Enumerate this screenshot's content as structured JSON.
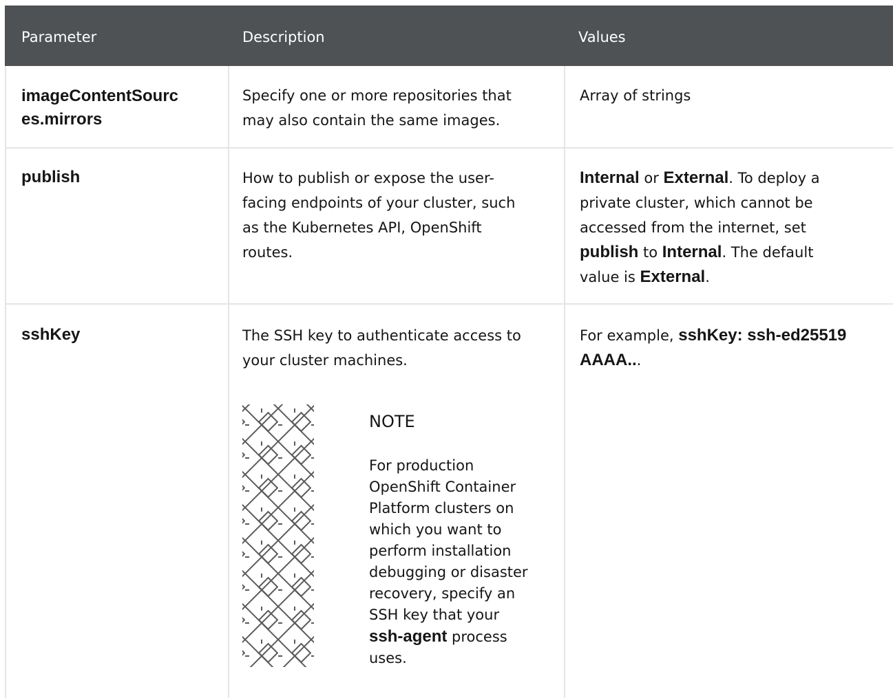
{
  "table": {
    "headers": {
      "parameter": "Parameter",
      "description": "Description",
      "values": "Values"
    },
    "rows": [
      {
        "parameter_line1": "imageContentSourc",
        "parameter_line2": "es.mirrors",
        "description": [
          "Specify one or more repositories that",
          "may also contain the same images."
        ],
        "values": "Array of strings"
      },
      {
        "parameter": "publish",
        "description": [
          "How to publish or expose the user-",
          "facing endpoints of your cluster, such",
          "as the Kubernetes API, OpenShift",
          "routes."
        ],
        "values": {
          "internal": "Internal",
          "or": " or ",
          "external": "External",
          "sentence1": ". To deploy a",
          "line2": "private cluster, which cannot be",
          "line3": "accessed from the internet, set",
          "publish": "publish",
          "to": " to ",
          "internal2": "Internal",
          "sentence2": ". The default",
          "value_is": "value is ",
          "external2": "External",
          "period": "."
        }
      },
      {
        "parameter": "sshKey",
        "description": [
          "The SSH key to authenticate access to",
          "your cluster machines."
        ],
        "values": {
          "prefix": "For example, ",
          "code_line1": "sshKey: ssh-ed25519",
          "code_line2": "AAAA..",
          "period": "."
        },
        "note": {
          "title": "NOTE",
          "lines": [
            "For production",
            "OpenShift Container",
            "Platform clusters on",
            "which you want to",
            "perform installation",
            "debugging or disaster",
            "recovery, specify an",
            "SSH key that your"
          ],
          "agent": "ssh-agent",
          "process": " process",
          "uses": "uses."
        }
      }
    ]
  },
  "icons": {
    "note": "note-pattern-icon"
  },
  "colors": {
    "header_bg": "#4f5255",
    "border": "#e5e5e5",
    "text": "#151515"
  }
}
